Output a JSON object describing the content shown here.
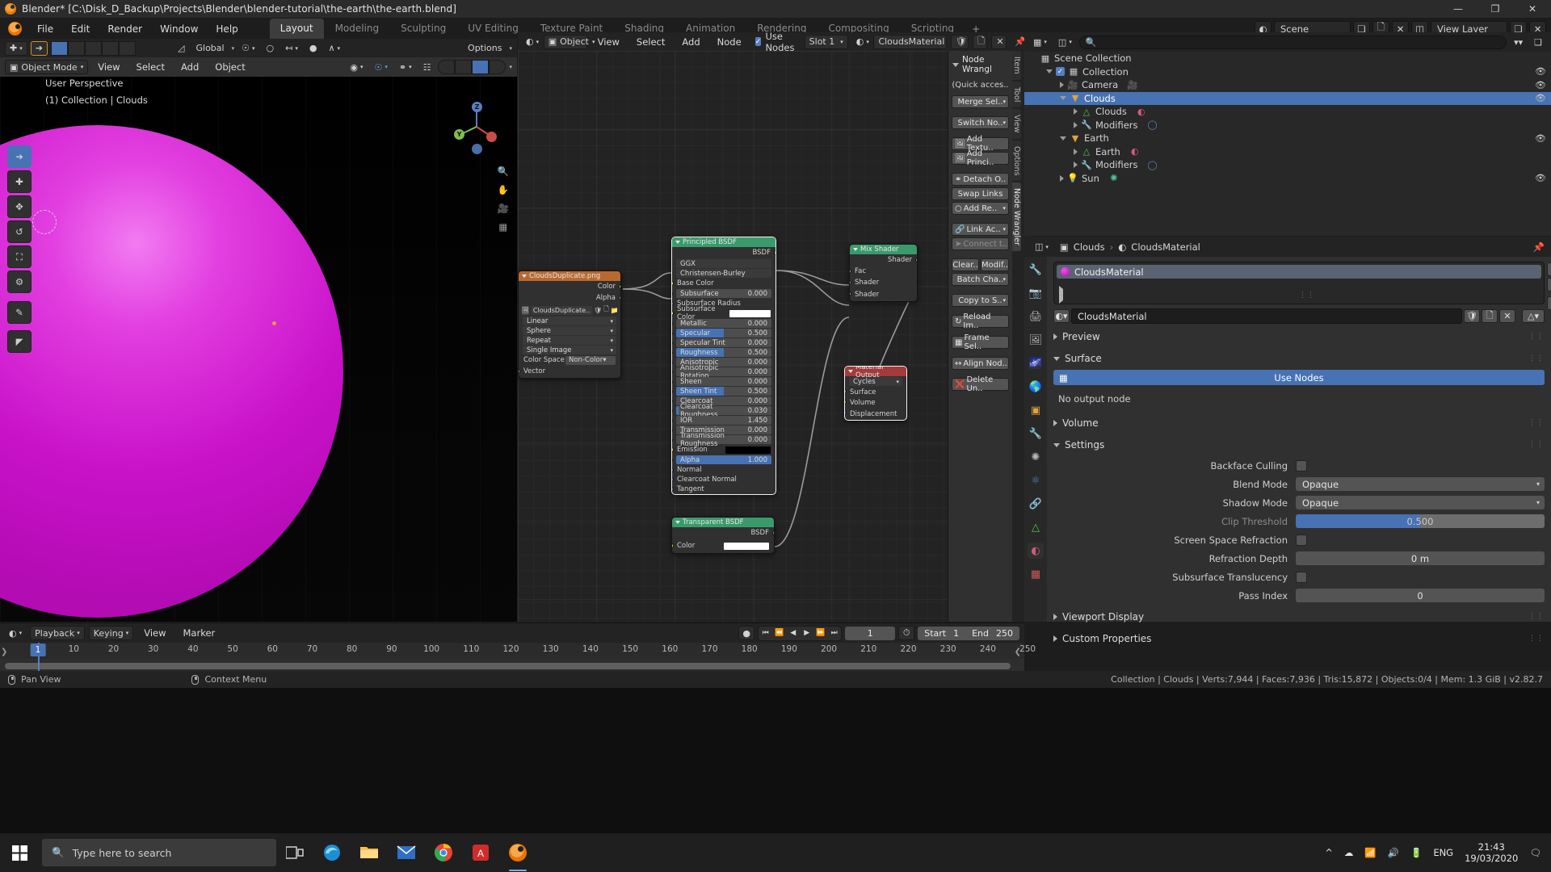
{
  "window": {
    "title": "Blender* [C:\\Disk_D_Backup\\Projects\\Blender\\blender-tutorial\\the-earth\\the-earth.blend]",
    "minimize": "—",
    "maximize": "❐",
    "close": "✕"
  },
  "topbar": {
    "menus": [
      "File",
      "Edit",
      "Render",
      "Window",
      "Help"
    ],
    "workspaces": [
      "Layout",
      "Modeling",
      "Sculpting",
      "UV Editing",
      "Texture Paint",
      "Shading",
      "Animation",
      "Rendering",
      "Compositing",
      "Scripting",
      "+"
    ],
    "active_workspace": "Layout",
    "scene_label": "Scene",
    "viewlayer_label": "View Layer"
  },
  "viewport": {
    "header": {
      "global_label": "Global",
      "options_label": "Options",
      "mode": "Object Mode",
      "menus": [
        "View",
        "Select",
        "Add",
        "Object"
      ]
    },
    "overlay_text_1": "User Perspective",
    "overlay_text_2": "(1) Collection | Clouds",
    "axis_labels": {
      "z": "Z",
      "y": "Y",
      "x": "X"
    },
    "material_label": "CloudsMaterial"
  },
  "node_editor": {
    "header": {
      "object_label": "Object",
      "menus": [
        "View",
        "Select",
        "Add",
        "Node"
      ],
      "use_nodes_label": "Use Nodes",
      "use_nodes_checked": true,
      "slot_label": "Slot 1",
      "material_name": "CloudsMaterial"
    },
    "nodes": [
      {
        "name": "image-texture-node",
        "title": "CloudsDuplicate.png",
        "header_color": "#b9692f",
        "outputs": [
          "Color",
          "Alpha"
        ],
        "image_name": "CloudsDuplicate..",
        "fields": [
          "Linear",
          "Sphere",
          "Repeat",
          "Single Image"
        ],
        "color_space_label": "Color Space",
        "color_space_value": "Non-Color",
        "vector_label": "Vector"
      },
      {
        "name": "principled-bsdf-node",
        "title": "Principled BSDF",
        "header_color": "#3a9a6a",
        "output": "BSDF",
        "distribution": "GGX",
        "subsurface_method": "Christensen-Burley",
        "rows": [
          {
            "label": "Base Color",
            "value": "",
            "type": "socket-color",
            "socket": "yellow"
          },
          {
            "label": "Subsurface",
            "value": "0.000",
            "type": "slider",
            "pct": 0,
            "socket": "gray"
          },
          {
            "label": "Subsurface Radius",
            "value": "",
            "type": "plain",
            "socket": "purple"
          },
          {
            "label": "Subsurface Color",
            "value": "",
            "type": "swatch-white",
            "socket": "yellow"
          },
          {
            "label": "Metallic",
            "value": "0.000",
            "type": "slider",
            "pct": 0,
            "socket": "gray"
          },
          {
            "label": "Specular",
            "value": "0.500",
            "type": "slider",
            "pct": 50,
            "socket": "gray"
          },
          {
            "label": "Specular Tint",
            "value": "0.000",
            "type": "slider",
            "pct": 0,
            "socket": "gray"
          },
          {
            "label": "Roughness",
            "value": "0.500",
            "type": "slider",
            "pct": 50,
            "socket": "gray"
          },
          {
            "label": "Anisotropic",
            "value": "0.000",
            "type": "slider",
            "pct": 0,
            "socket": "gray"
          },
          {
            "label": "Anisotropic Rotation",
            "value": "0.000",
            "type": "slider",
            "pct": 0,
            "socket": "gray"
          },
          {
            "label": "Sheen",
            "value": "0.000",
            "type": "slider",
            "pct": 0,
            "socket": "gray"
          },
          {
            "label": "Sheen Tint",
            "value": "0.500",
            "type": "slider",
            "pct": 50,
            "socket": "gray"
          },
          {
            "label": "Clearcoat",
            "value": "0.000",
            "type": "slider",
            "pct": 0,
            "socket": "gray"
          },
          {
            "label": "Clearcoat Roughness",
            "value": "0.030",
            "type": "slider",
            "pct": 3,
            "socket": "gray"
          },
          {
            "label": "IOR",
            "value": "1.450",
            "type": "slider",
            "pct": 0,
            "socket": "gray"
          },
          {
            "label": "Transmission",
            "value": "0.000",
            "type": "slider",
            "pct": 0,
            "socket": "gray"
          },
          {
            "label": "Transmission Roughness",
            "value": "0.000",
            "type": "slider",
            "pct": 0,
            "socket": "gray"
          },
          {
            "label": "Emission",
            "value": "",
            "type": "swatch-black",
            "socket": "yellow"
          },
          {
            "label": "Alpha",
            "value": "1.000",
            "type": "slider",
            "pct": 100,
            "socket": "gray"
          },
          {
            "label": "Normal",
            "value": "",
            "type": "plain",
            "socket": "purple"
          },
          {
            "label": "Clearcoat Normal",
            "value": "",
            "type": "plain",
            "socket": "purple"
          },
          {
            "label": "Tangent",
            "value": "",
            "type": "plain",
            "socket": "purple"
          }
        ]
      },
      {
        "name": "mix-shader-node",
        "title": "Mix Shader",
        "header_color": "#3a9a6a",
        "output": "Shader",
        "inputs": [
          "Fac",
          "Shader",
          "Shader"
        ]
      },
      {
        "name": "material-output-node",
        "title": "Material Output",
        "header_color": "#a33b3b",
        "engine": "Cycles",
        "inputs": [
          "Surface",
          "Volume",
          "Displacement"
        ]
      },
      {
        "name": "transparent-bsdf-node",
        "title": "Transparent BSDF",
        "header_color": "#3a9a6a",
        "output": "BSDF",
        "color_label": "Color"
      }
    ]
  },
  "node_wrangler": {
    "title": "Node Wrangl",
    "subtitle": "(Quick acces..",
    "buttons": [
      "Merge Sel..",
      "Switch No..",
      "Add Textu..",
      "Add Princi..",
      "Detach O..",
      "Swap Links",
      "Add Re..",
      "Link Ac..",
      "Connect t..",
      "Clear..",
      "Modif..",
      "Batch Cha..",
      "Copy to S..",
      "Reload Im..",
      "Frame Sel..",
      "Align Nod..",
      "Delete Un.."
    ],
    "vertical_tabs": [
      "Item",
      "Tool",
      "View",
      "Options",
      "Node Wrangler"
    ],
    "active_vertical_tab": "Node Wrangler"
  },
  "outliner": {
    "rows": [
      {
        "label": "Scene Collection",
        "indent": 0,
        "icon": "collection-icon",
        "selected": false,
        "eye": false,
        "disclosure": "none",
        "checkbox": false
      },
      {
        "label": "Collection",
        "indent": 1,
        "icon": "collection-icon",
        "selected": false,
        "eye": true,
        "disclosure": "open",
        "checkbox": true
      },
      {
        "label": "Camera",
        "indent": 2,
        "icon": "camera-icon",
        "selected": false,
        "eye": true,
        "disclosure": "closed",
        "checkbox": false,
        "data_icon": "camera-data-icon"
      },
      {
        "label": "Clouds",
        "indent": 2,
        "icon": "mesh-object-icon",
        "selected": true,
        "eye": true,
        "disclosure": "open",
        "checkbox": false
      },
      {
        "label": "Clouds",
        "indent": 3,
        "icon": "mesh-data-icon",
        "selected": false,
        "eye": false,
        "disclosure": "closed",
        "checkbox": false,
        "data_icon": "material-icon"
      },
      {
        "label": "Modifiers",
        "indent": 3,
        "icon": "wrench-icon",
        "selected": false,
        "eye": false,
        "disclosure": "closed",
        "checkbox": false,
        "data_icon": "modifier-icon"
      },
      {
        "label": "Earth",
        "indent": 2,
        "icon": "mesh-object-icon",
        "selected": false,
        "eye": true,
        "disclosure": "open",
        "checkbox": false
      },
      {
        "label": "Earth",
        "indent": 3,
        "icon": "mesh-data-icon",
        "selected": false,
        "eye": false,
        "disclosure": "closed",
        "checkbox": false,
        "data_icon": "material-icon"
      },
      {
        "label": "Modifiers",
        "indent": 3,
        "icon": "wrench-icon",
        "selected": false,
        "eye": false,
        "disclosure": "closed",
        "checkbox": false,
        "data_icon": "modifier-icon"
      },
      {
        "label": "Sun",
        "indent": 2,
        "icon": "light-icon",
        "selected": false,
        "eye": true,
        "disclosure": "closed",
        "checkbox": false,
        "data_icon": "sun-data-icon"
      }
    ]
  },
  "properties": {
    "breadcrumb_object": "Clouds",
    "breadcrumb_material": "CloudsMaterial",
    "material_slot_name": "CloudsMaterial",
    "material_id_name": "CloudsMaterial",
    "panels": {
      "preview": "Preview",
      "surface": "Surface",
      "volume": "Volume",
      "settings": "Settings",
      "viewport_display": "Viewport Display",
      "custom_properties": "Custom Properties"
    },
    "use_nodes_label": "Use Nodes",
    "no_output_node": "No output node",
    "settings_rows": [
      {
        "label": "Backface Culling",
        "value": "",
        "type": "checkbox"
      },
      {
        "label": "Blend Mode",
        "value": "Opaque",
        "type": "dropdown"
      },
      {
        "label": "Shadow Mode",
        "value": "Opaque",
        "type": "dropdown"
      },
      {
        "label": "Clip Threshold",
        "value": "0.500",
        "type": "slider",
        "dim": true
      },
      {
        "label": "Screen Space Refraction",
        "value": "",
        "type": "checkbox"
      },
      {
        "label": "Refraction Depth",
        "value": "0 m",
        "type": "number"
      },
      {
        "label": "Subsurface Translucency",
        "value": "",
        "type": "checkbox"
      },
      {
        "label": "Pass Index",
        "value": "0",
        "type": "number"
      }
    ]
  },
  "timeline": {
    "menus": [
      "Playback",
      "Keying",
      "View",
      "Marker"
    ],
    "current_frame": "1",
    "start_label": "Start",
    "start_value": "1",
    "end_label": "End",
    "end_value": "250",
    "ticks": [
      "1",
      "10",
      "20",
      "30",
      "40",
      "50",
      "60",
      "70",
      "80",
      "90",
      "100",
      "110",
      "120",
      "130",
      "140",
      "150",
      "160",
      "170",
      "180",
      "190",
      "200",
      "210",
      "220",
      "230",
      "240",
      "250"
    ],
    "playhead_frame": "1"
  },
  "status_bar": {
    "pan_view": "Pan View",
    "context_menu": "Context Menu",
    "stats": "Collection | Clouds | Verts:7,944 | Faces:7,936 | Tris:15,872 | Objects:0/4 | Mem: 1.3 GiB | v2.82.7"
  },
  "taskbar": {
    "search_placeholder": "Type here to search",
    "language": "ENG",
    "time": "21:43",
    "date": "19/03/2020"
  }
}
